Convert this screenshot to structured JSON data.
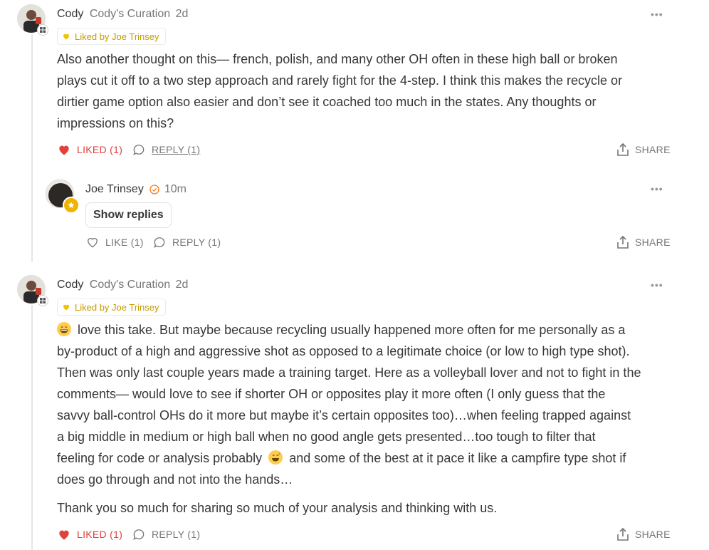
{
  "comments": [
    {
      "author": "Cody",
      "publication": "Cody's Curation",
      "time": "2d",
      "liked_by": "Liked by Joe Trinsey",
      "text": "Also another thought on this— french, polish, and many other OH often in these high ball or broken plays cut it off to a two step approach and rarely fight for the 4-step. I think this makes the recycle or dirtier game option also easier and don’t see it coached too much in the states. Any thoughts or impressions on this?",
      "lines": [
        "Also another thought on this— french, polish, and many other OH often in these high ball or broken",
        "plays cut it off to a two step approach and rarely fight for the 4-step. I think this makes the recycle or",
        "dirtier game option also easier and don’t see it coached too much in the states. Any thoughts or",
        "impressions on this?"
      ],
      "like_label": "LIKED (1)",
      "reply_label": "REPLY (1)",
      "share_label": "SHARE"
    },
    {
      "author": "Cody",
      "publication": "Cody's Curation",
      "time": "2d",
      "liked_by": "Liked by Joe Trinsey",
      "lines": [
        " love this take. But maybe because recycling usually happened more often for me personally as a",
        "by-product of a high and aggressive shot as opposed to a legitimate choice (or low to high type shot).",
        "Then was only last couple years made a training target. Here as a volleyball lover and not to fight in the",
        "comments— would love to see if shorter OH or opposites play it more often (I only guess that the",
        "savvy ball-control OHs do it more but maybe it’s certain opposites too)…when feeling trapped against",
        "a big middle in medium or high ball when no good angle gets presented…too tough to filter that",
        "feeling for code or analysis probably",
        " and some of the best at it pace it like a campfire type shot if",
        "does go through and not into the hands…"
      ],
      "closing": "Thank you so much for sharing so much of your analysis and thinking with us.",
      "like_label": "LIKED (1)",
      "reply_label": "REPLY (1)",
      "share_label": "SHARE"
    }
  ],
  "reply": {
    "author": "Joe Trinsey",
    "time": "10m",
    "show_replies": "Show replies",
    "like_label": "LIKE (1)",
    "reply_label": "REPLY (1)",
    "share_label": "SHARE"
  },
  "colors": {
    "liked_red": "#e0413b",
    "gold": "#c49a00",
    "text": "#363737",
    "muted": "#757575"
  },
  "icons": [
    "more-icon",
    "heart-icon",
    "comment-icon",
    "share-icon",
    "check-badge-icon",
    "star-badge-icon",
    "grin-emoji",
    "sweat-smile-emoji"
  ]
}
